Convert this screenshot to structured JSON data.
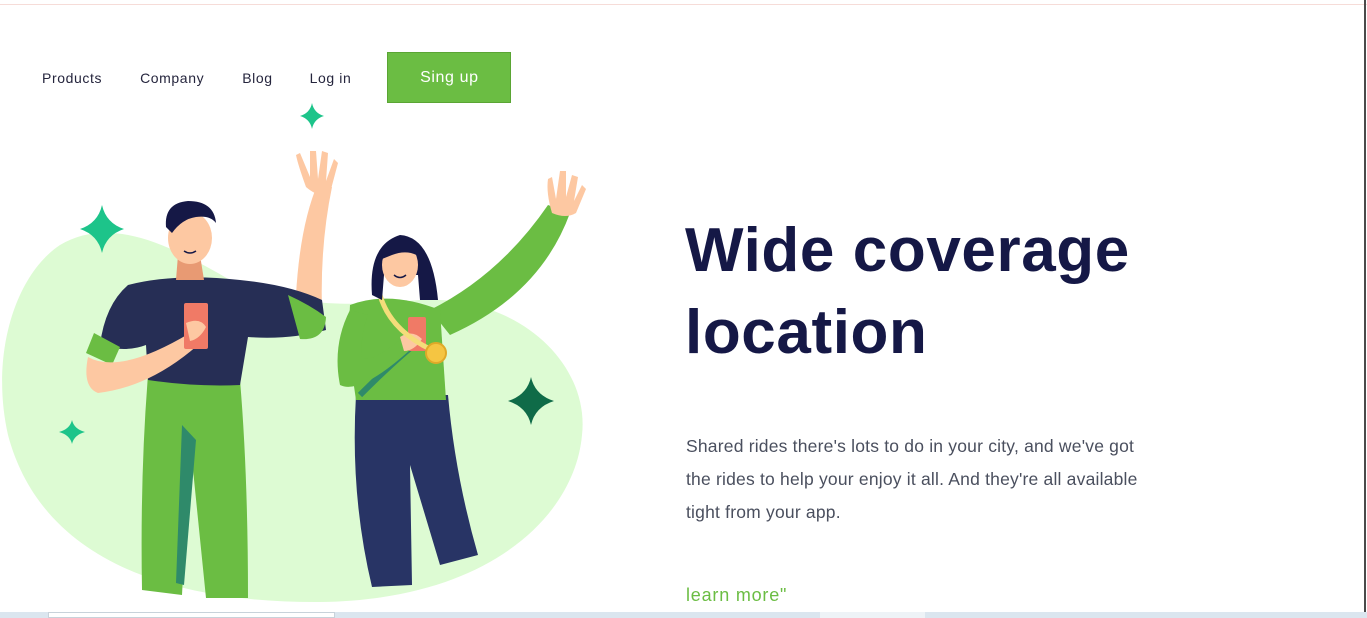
{
  "nav": {
    "products": "Products",
    "company": "Company",
    "blog": "Blog",
    "login": "Log in",
    "signup": "Sing up"
  },
  "hero": {
    "title_line1": "Wide coverage",
    "title_line2": "location",
    "body_line1": "Shared rides there's lots to do in your city, and we've got",
    "body_line2": "the rides to help your enjoy it all. And they're all available",
    "body_line3": "tight from your app.",
    "learn_more": "learn more\""
  },
  "colors": {
    "accent": "#6bbd43",
    "title": "#151846",
    "blob": "#ddfbd3",
    "sparkle": "#1dc48a"
  },
  "illustration": {
    "icons": [
      "sparkle-icon",
      "man-waving",
      "woman-waving"
    ]
  }
}
